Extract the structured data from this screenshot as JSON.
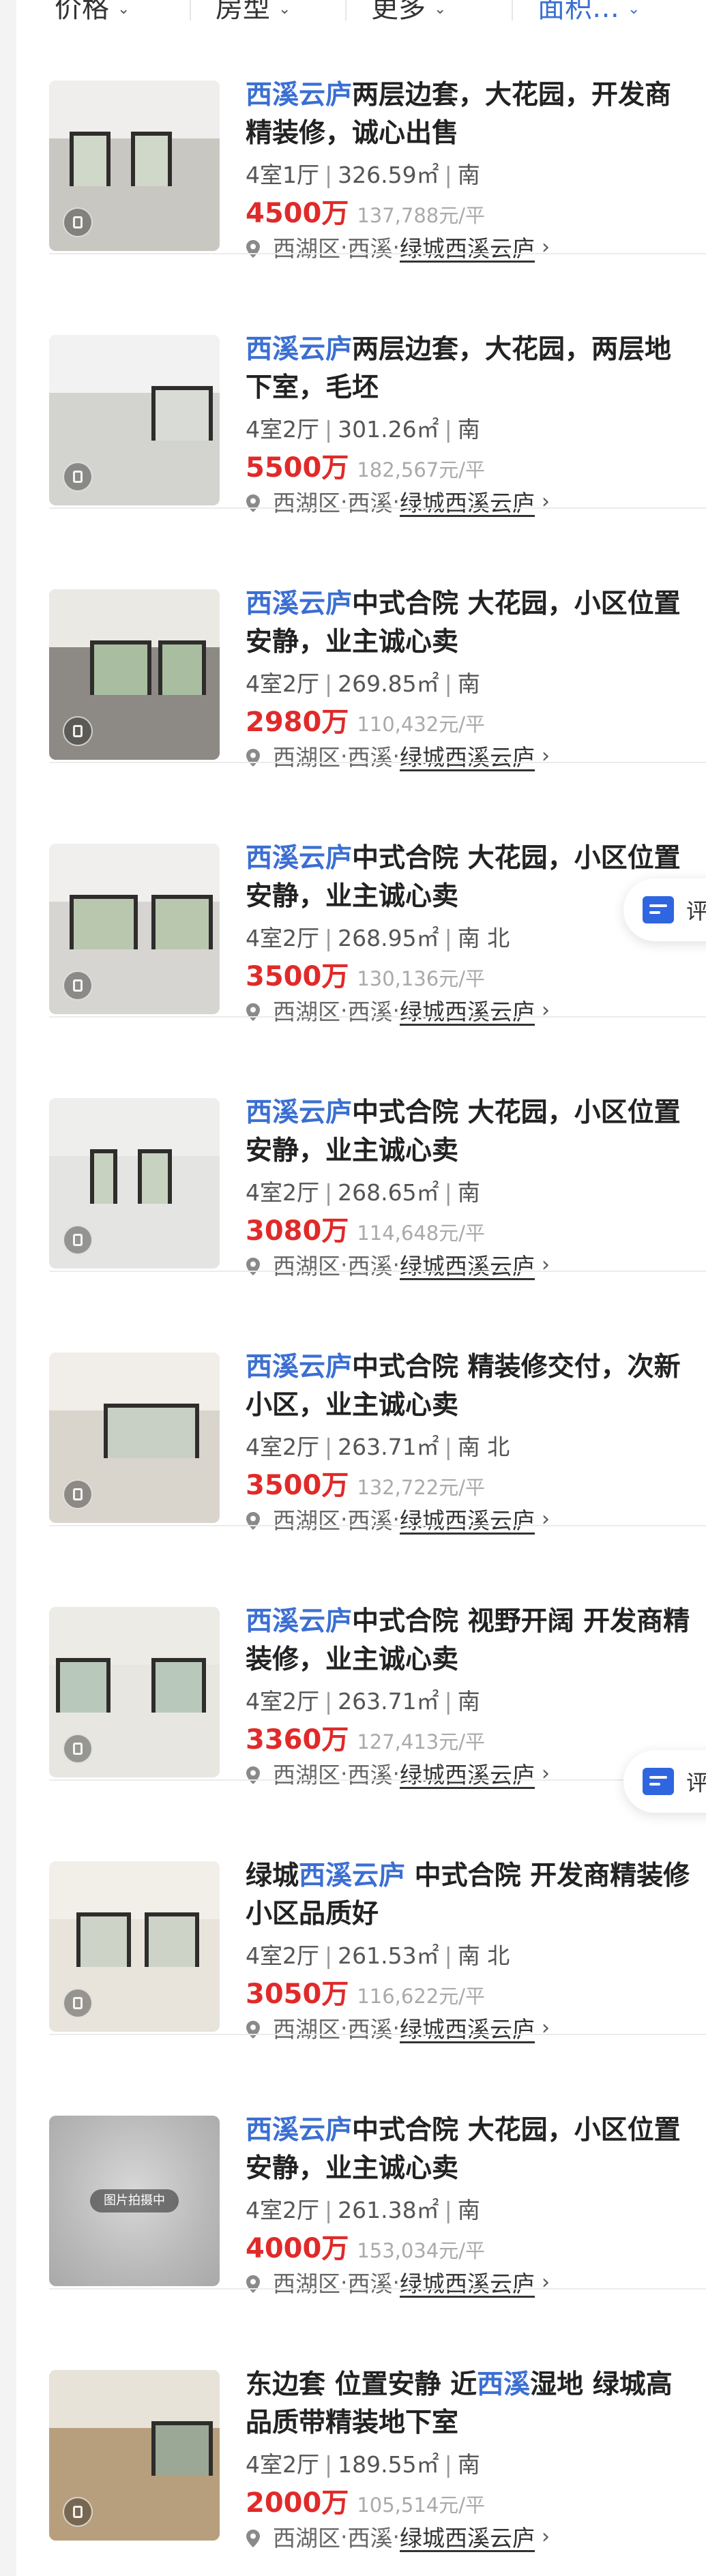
{
  "filters": [
    {
      "label": "价格",
      "active": false
    },
    {
      "label": "房型",
      "active": false
    },
    {
      "label": "更多",
      "active": false
    },
    {
      "label": "面积…",
      "active": true
    }
  ],
  "eval_label": "评价",
  "listings": [
    {
      "title_segments": [
        {
          "t": "西溪云庐",
          "hl": true
        },
        {
          "t": "两层边套，大花园，开发商精装修，诚心出售",
          "hl": false
        }
      ],
      "layout": "4室1厅",
      "area": "326.59㎡",
      "orientation": "南",
      "price": "4500万",
      "unit_price": "137,788元/平",
      "district": "西湖区",
      "area_name": "西溪",
      "community": "绿城西溪云庐",
      "photo": "ok"
    },
    {
      "title_segments": [
        {
          "t": "西溪云庐",
          "hl": true
        },
        {
          "t": "两层边套，大花园，两层地下室，毛坯",
          "hl": false
        }
      ],
      "layout": "4室2厅",
      "area": "301.26㎡",
      "orientation": "南",
      "price": "5500万",
      "unit_price": "182,567元/平",
      "district": "西湖区",
      "area_name": "西溪",
      "community": "绿城西溪云庐",
      "photo": "ok"
    },
    {
      "title_segments": [
        {
          "t": "西溪云庐",
          "hl": true
        },
        {
          "t": "中式合院 大花园，小区位置安静，业主诚心卖",
          "hl": false
        }
      ],
      "layout": "4室2厅",
      "area": "269.85㎡",
      "orientation": "南",
      "price": "2980万",
      "unit_price": "110,432元/平",
      "district": "西湖区",
      "area_name": "西溪",
      "community": "绿城西溪云庐",
      "photo": "ok"
    },
    {
      "title_segments": [
        {
          "t": "西溪云庐",
          "hl": true
        },
        {
          "t": "中式合院 大花园，小区位置安静，业主诚心卖",
          "hl": false
        }
      ],
      "layout": "4室2厅",
      "area": "268.95㎡",
      "orientation": "南 北",
      "price": "3500万",
      "unit_price": "130,136元/平",
      "district": "西湖区",
      "area_name": "西溪",
      "community": "绿城西溪云庐",
      "photo": "ok"
    },
    {
      "title_segments": [
        {
          "t": "西溪云庐",
          "hl": true
        },
        {
          "t": "中式合院 大花园，小区位置安静，业主诚心卖",
          "hl": false
        }
      ],
      "layout": "4室2厅",
      "area": "268.65㎡",
      "orientation": "南",
      "price": "3080万",
      "unit_price": "114,648元/平",
      "district": "西湖区",
      "area_name": "西溪",
      "community": "绿城西溪云庐",
      "photo": "ok"
    },
    {
      "title_segments": [
        {
          "t": "西溪云庐",
          "hl": true
        },
        {
          "t": "中式合院 精装修交付，次新小区，业主诚心卖",
          "hl": false
        }
      ],
      "layout": "4室2厅",
      "area": "263.71㎡",
      "orientation": "南 北",
      "price": "3500万",
      "unit_price": "132,722元/平",
      "district": "西湖区",
      "area_name": "西溪",
      "community": "绿城西溪云庐",
      "photo": "ok"
    },
    {
      "title_segments": [
        {
          "t": "西溪云庐",
          "hl": true
        },
        {
          "t": "中式合院 视野开阔 开发商精装修，业主诚心卖",
          "hl": false
        }
      ],
      "layout": "4室2厅",
      "area": "263.71㎡",
      "orientation": "南",
      "price": "3360万",
      "unit_price": "127,413元/平",
      "district": "西湖区",
      "area_name": "西溪",
      "community": "绿城西溪云庐",
      "photo": "ok"
    },
    {
      "title_segments": [
        {
          "t": "绿城",
          "hl": false
        },
        {
          "t": "西溪云庐",
          "hl": true
        },
        {
          "t": " 中式合院 开发商精装修 小区品质好",
          "hl": false
        }
      ],
      "layout": "4室2厅",
      "area": "261.53㎡",
      "orientation": "南 北",
      "price": "3050万",
      "unit_price": "116,622元/平",
      "district": "西湖区",
      "area_name": "西溪",
      "community": "绿城西溪云庐",
      "photo": "ok"
    },
    {
      "title_segments": [
        {
          "t": "西溪云庐",
          "hl": true
        },
        {
          "t": "中式合院 大花园，小区位置安静，业主诚心卖",
          "hl": false
        }
      ],
      "layout": "4室2厅",
      "area": "261.38㎡",
      "orientation": "南",
      "price": "4000万",
      "unit_price": "153,034元/平",
      "district": "西湖区",
      "area_name": "西溪",
      "community": "绿城西溪云庐",
      "photo": "shooting",
      "photo_label": "图片拍摄中"
    },
    {
      "title_segments": [
        {
          "t": "东边套 位置安静 近",
          "hl": false
        },
        {
          "t": "西溪",
          "hl": true
        },
        {
          "t": "湿地 绿城高品质带精装地下室",
          "hl": false
        }
      ],
      "layout": "4室2厅",
      "area": "189.55㎡",
      "orientation": "南",
      "price": "2000万",
      "unit_price": "105,514元/平",
      "district": "西湖区",
      "area_name": "西溪",
      "community": "绿城西溪云庐",
      "photo": "ok"
    }
  ]
}
